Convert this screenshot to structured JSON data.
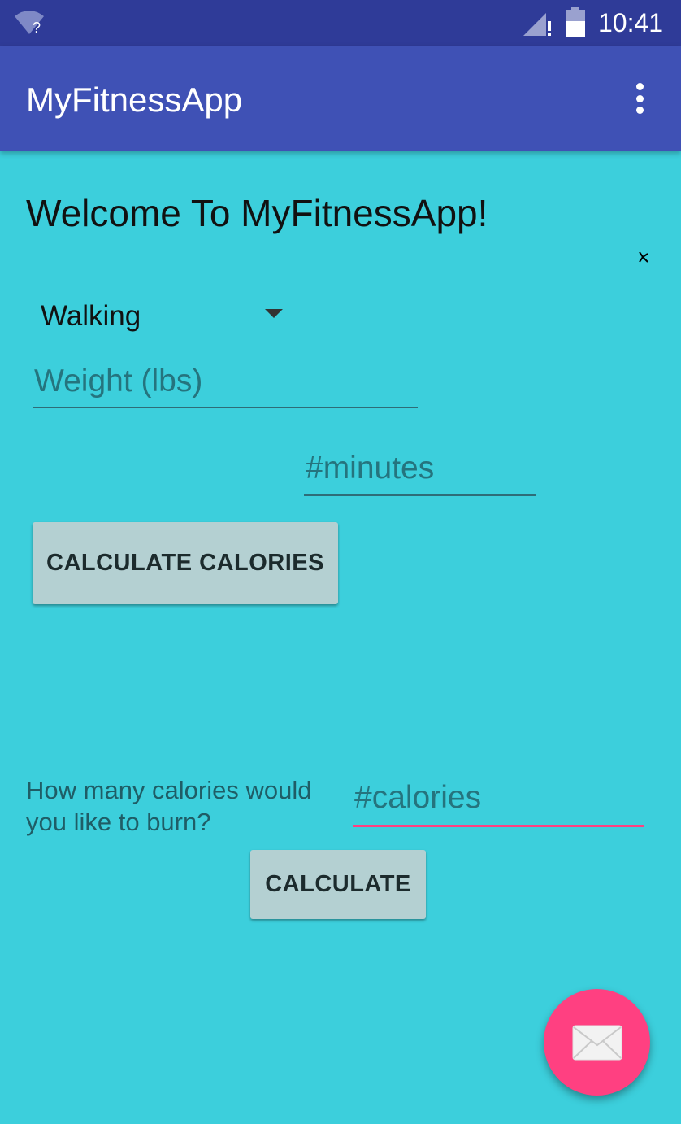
{
  "status_bar": {
    "time": "10:41",
    "wifi_icon": "wifi-unknown-icon",
    "signal_icon": "signal-icon",
    "battery_icon": "battery-icon"
  },
  "app_bar": {
    "title": "MyFitnessApp",
    "overflow_icon": "more-vert-icon"
  },
  "main": {
    "welcome": "Welcome To MyFitnessApp!",
    "activity_spinner": {
      "selected": "Walking"
    },
    "weight_input": {
      "placeholder": "Weight (lbs)",
      "value": ""
    },
    "minutes_input": {
      "placeholder": "#minutes",
      "value": ""
    },
    "calculate_calories_button": "CALCULATE CALORIES",
    "question": "How many calories would you like to burn?",
    "calories_input": {
      "placeholder": "#calories",
      "value": ""
    },
    "calculate_button": "CALCULATE"
  },
  "fab": {
    "icon": "email-icon"
  },
  "colors": {
    "status_bar": "#2f3b98",
    "app_bar": "#3f51b5",
    "background": "#3ccfdc",
    "accent": "#ff4081",
    "button": "#b4d0d2"
  }
}
